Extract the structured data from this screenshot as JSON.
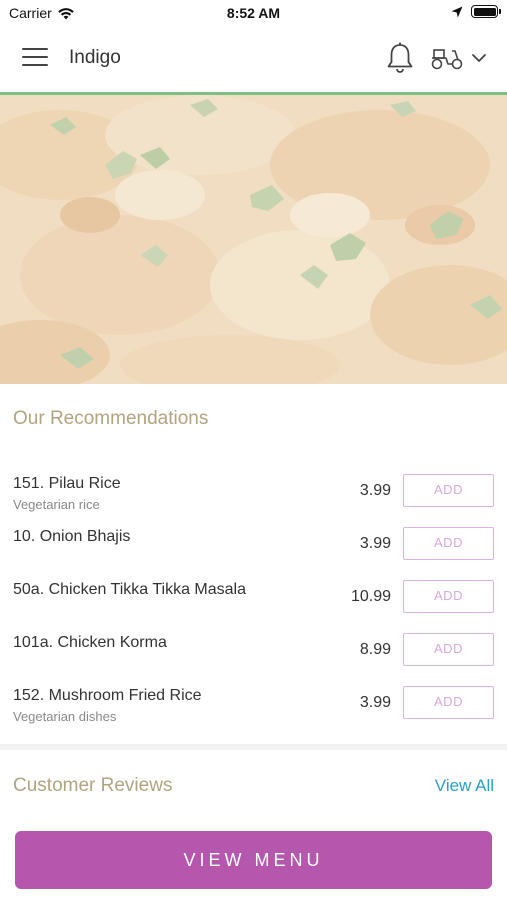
{
  "status_bar": {
    "carrier": "Carrier",
    "time": "8:52 AM"
  },
  "header": {
    "title": "Indigo",
    "icons": [
      "menu-icon",
      "bell-icon",
      "scooter-icon",
      "chevron-down-icon"
    ]
  },
  "hero": {
    "image_description_icon": "food-photo"
  },
  "recommendations": {
    "title": "Our Recommendations",
    "add_label": "ADD",
    "items": [
      {
        "name": "151. Pilau Rice",
        "desc": "Vegetarian rice",
        "price": "3.99"
      },
      {
        "name": "10. Onion Bhajis",
        "desc": "",
        "price": "3.99"
      },
      {
        "name": "50a. Chicken Tikka Tikka Masala",
        "desc": "",
        "price": "10.99"
      },
      {
        "name": "101a. Chicken Korma",
        "desc": "",
        "price": "8.99"
      },
      {
        "name": "152. Mushroom Fried Rice",
        "desc": "Vegetarian dishes",
        "price": "3.99"
      }
    ]
  },
  "reviews": {
    "title": "Customer Reviews",
    "view_all": "View All"
  },
  "footer": {
    "view_menu": "VIEW MENU"
  },
  "colors": {
    "accent_purple": "#b558ad",
    "add_border": "#dcb3e0",
    "section_title": "#b1a47f",
    "link_blue": "#2a9fc9",
    "header_rule": "#7fbf86"
  }
}
